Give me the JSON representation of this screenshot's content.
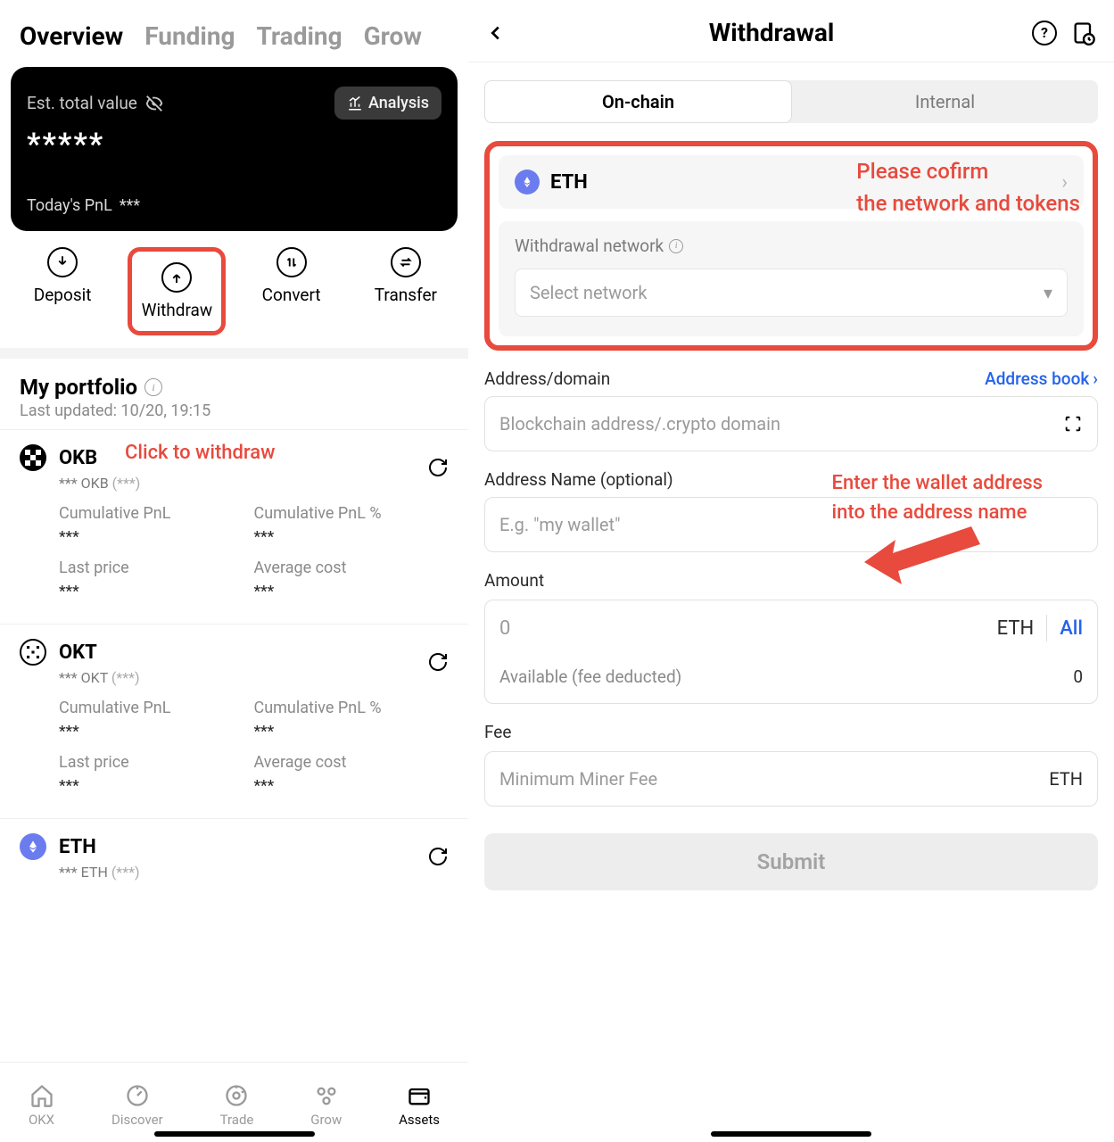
{
  "left": {
    "tabs": [
      "Overview",
      "Funding",
      "Trading",
      "Grow"
    ],
    "activeTab": 0,
    "card": {
      "estLabel": "Est. total value",
      "analysis": "Analysis",
      "hiddenValue": "*****",
      "pnlLabel": "Today's PnL",
      "pnlValue": "***"
    },
    "actions": {
      "deposit": "Deposit",
      "withdraw": "Withdraw",
      "convert": "Convert",
      "transfer": "Transfer"
    },
    "portfolio": {
      "title": "My portfolio",
      "updated": "Last updated: 10/20, 19:15"
    },
    "annotation": "Click to withdraw",
    "assets": [
      {
        "symbol": "OKB",
        "subPrefix": "*** OKB",
        "subParen": "(***)",
        "cumPnlLabel": "Cumulative PnL",
        "cumPnlVal": "***",
        "cumPnlPctLabel": "Cumulative PnL %",
        "cumPnlPctVal": "***",
        "lastPriceLabel": "Last price",
        "lastPriceVal": "***",
        "avgCostLabel": "Average cost",
        "avgCostVal": "***"
      },
      {
        "symbol": "OKT",
        "subPrefix": "*** OKT",
        "subParen": "(***)",
        "cumPnlLabel": "Cumulative PnL",
        "cumPnlVal": "***",
        "cumPnlPctLabel": "Cumulative PnL %",
        "cumPnlPctVal": "***",
        "lastPriceLabel": "Last price",
        "lastPriceVal": "***",
        "avgCostLabel": "Average cost",
        "avgCostVal": "***"
      },
      {
        "symbol": "ETH",
        "subPrefix": "*** ETH",
        "subParen": "(***)"
      }
    ],
    "nav": {
      "okx": "OKX",
      "discover": "Discover",
      "trade": "Trade",
      "grow": "Grow",
      "assets": "Assets"
    }
  },
  "right": {
    "title": "Withdrawal",
    "segments": {
      "onchain": "On-chain",
      "internal": "Internal"
    },
    "token": "ETH",
    "networkLabel": "Withdrawal network",
    "networkPlaceholder": "Select network",
    "annotation1_line1": "Please cofirm",
    "annotation1_line2": "the network and tokens",
    "addressLabel": "Address/domain",
    "addressBook": "Address book",
    "addressPlaceholder": "Blockchain address/.crypto domain",
    "addressNameLabel": "Address Name (optional)",
    "addressNamePlaceholder": "E.g. \"my wallet\"",
    "annotation2_line1": "Enter the wallet address",
    "annotation2_line2": "into the address name",
    "amountLabel": "Amount",
    "amountPlaceholder": "0",
    "amountUnit": "ETH",
    "amountAll": "All",
    "availableLabel": "Available (fee deducted)",
    "availableVal": "0",
    "feeLabel": "Fee",
    "feePlaceholder": "Minimum Miner Fee",
    "feeUnit": "ETH",
    "submit": "Submit"
  }
}
